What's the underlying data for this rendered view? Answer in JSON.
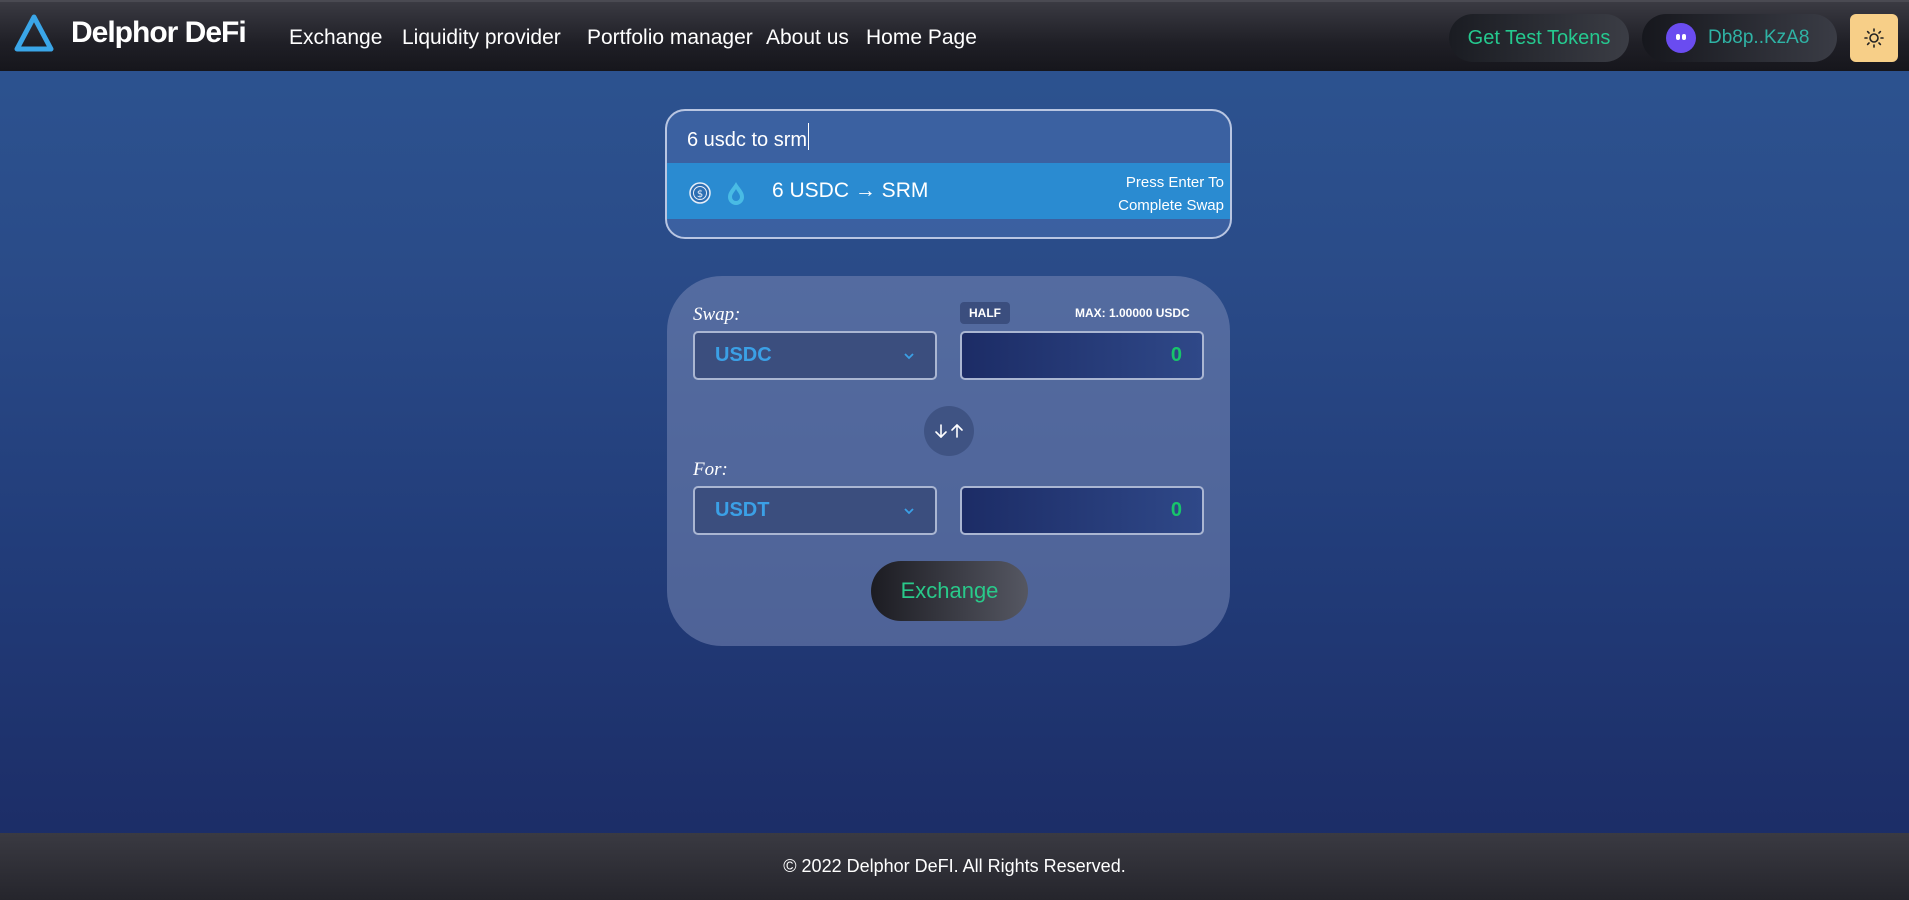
{
  "header": {
    "brand": "Delphor DeFi",
    "nav": [
      "Exchange",
      "Liquidity provider",
      "Portfolio manager",
      "About us",
      "Home Page"
    ],
    "get_tokens_label": "Get Test Tokens",
    "wallet_label": "Db8p..KzA8",
    "theme_icon": "sun-icon"
  },
  "search": {
    "value": "6 usdc to srm",
    "suggestion": {
      "text": "6 USDC → SRM",
      "hint_line1": "Press Enter To",
      "hint_line2": "Complete Swap",
      "icons": [
        "usdc-icon",
        "srm-icon"
      ]
    }
  },
  "swap": {
    "swap_label": "Swap:",
    "for_label": "For:",
    "from_token": "USDC",
    "to_token": "USDT",
    "from_amount": "0",
    "to_amount": "0",
    "half_label": "HALF",
    "max_label": "MAX: 1.00000 USDC",
    "exchange_label": "Exchange"
  },
  "footer": {
    "copyright": "© 2022 Delphor DeFI. All Rights Reserved."
  },
  "colors": {
    "accent_green": "#29c98a",
    "token_blue": "#3ba0e6",
    "suggestion_bg": "#2a8bd1",
    "theme_btn": "#f7cf88"
  }
}
